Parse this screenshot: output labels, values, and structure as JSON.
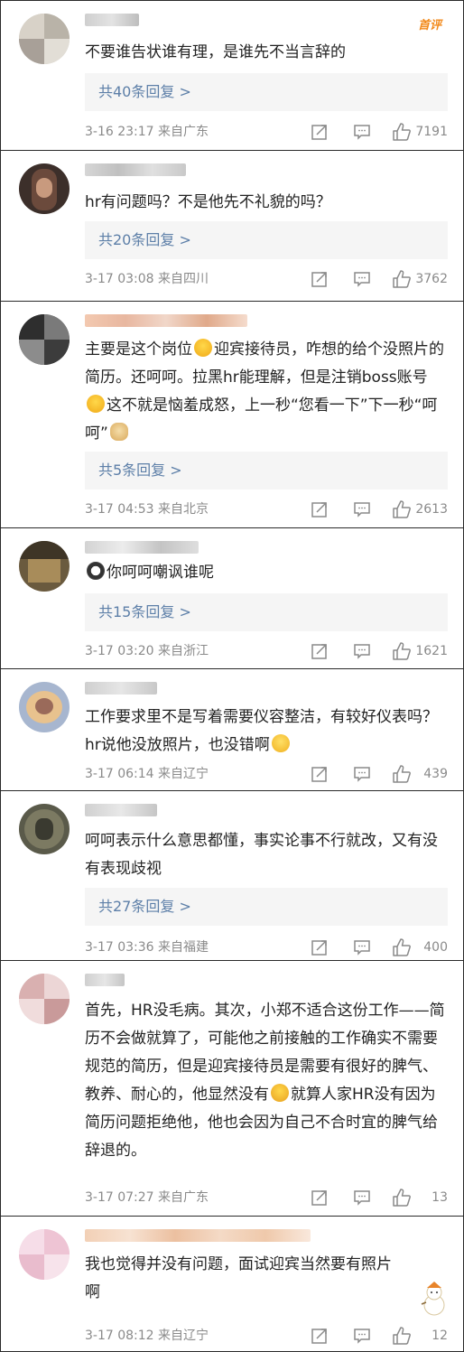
{
  "hot_tag": "首评",
  "comments": [
    {
      "text_parts": [
        "不要谁告状谁有理，是谁先不当言辞的"
      ],
      "replies": "共40条回复 >",
      "time": "3-16 23:17  来自广东",
      "likes": "7191",
      "share_icon": "share-icon",
      "comment_icon": "comment-icon",
      "like_icon": "thumbs-up-icon"
    },
    {
      "text_parts": [
        "hr有问题吗？不是他先不礼貌的吗？"
      ],
      "replies": "共20条回复 >",
      "time": "3-17 03:08  来自四川",
      "likes": "3762"
    },
    {
      "text_parts": [
        "主要是这个岗位",
        "迎宾接待员，咋想的给个没照片的简历。还呵呵。拉黑hr能理解，但是注销boss账号",
        "这不就是恼羞成怒，上一秒“您看一下”下一秒“呵呵”"
      ],
      "replies": "共5条回复 >",
      "time": "3-17 04:53  来自北京",
      "likes": "2613"
    },
    {
      "text_parts": [
        "你呵呵嘲讽谁呢"
      ],
      "replies": "共15条回复 >",
      "time": "3-17 03:20  来自浙江",
      "likes": "1621"
    },
    {
      "text_parts": [
        "工作要求里不是写着需要仪容整洁，有较好仪表吗？hr说他没放照片，也没错啊"
      ],
      "time": "3-17 06:14  来自辽宁",
      "likes": "439"
    },
    {
      "text_parts": [
        "呵呵表示什么意思都懂，事实论事不行就改，又有没有表现歧视"
      ],
      "replies": "共27条回复 >",
      "time": "3-17 03:36  来自福建",
      "likes": "400"
    },
    {
      "text_parts": [
        "首先，HR没毛病。其次，小郑不适合这份工作——简历不会做就算了，可能他之前接触的工作确实不需要规范的简历，但是迎宾接待员是需要有很好的脾气、教养、耐心的，他显然没有",
        "就算人家HR没有因为简历问题拒绝他，他也会因为自己不合时宜的脾气给辞退的。"
      ],
      "time": "3-17 07:27  来自广东",
      "likes": "13"
    },
    {
      "text_parts": [
        "我也觉得并没有问题，面试迎宾当然要有照片啊"
      ],
      "time": "3-17 08:12  来自辽宁",
      "likes": "12"
    }
  ],
  "colors": {
    "link": "#5d7fa8",
    "meta": "#8a8a8a",
    "text": "#222222",
    "reply_bg": "#f5f5f5",
    "hot": "#f28a1c"
  }
}
